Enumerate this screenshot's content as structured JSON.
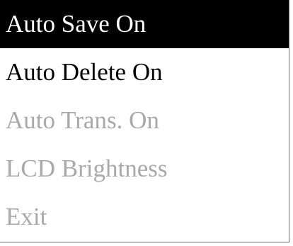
{
  "menu": {
    "items": [
      {
        "label": "Auto Save On",
        "state": "selected"
      },
      {
        "label": "Auto Delete On",
        "state": "enabled"
      },
      {
        "label": "Auto Trans. On",
        "state": "disabled"
      },
      {
        "label": "LCD Brightness",
        "state": "disabled"
      },
      {
        "label": "Exit",
        "state": "disabled"
      }
    ]
  },
  "colors": {
    "background": "#ffffff",
    "selected_background": "#000000",
    "selected_text": "#ffffff",
    "enabled_text": "#000000",
    "disabled_text": "#a9a9a9"
  }
}
